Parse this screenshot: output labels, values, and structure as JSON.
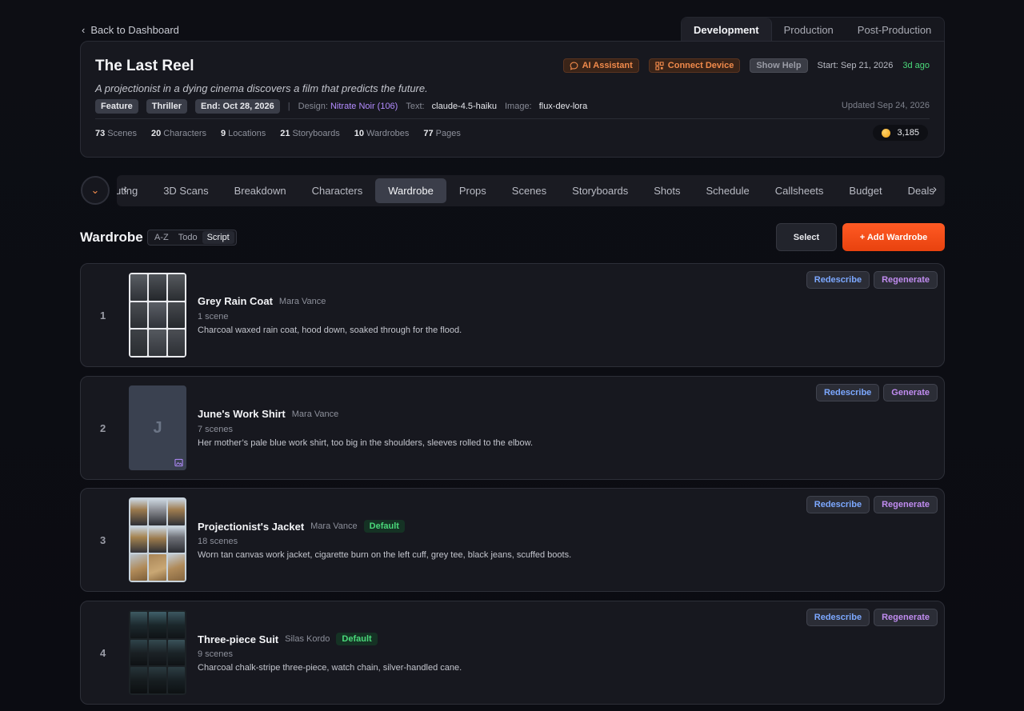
{
  "nav": {
    "back_label": "Back to Dashboard",
    "phase_tabs": [
      "Development",
      "Production",
      "Post-Production"
    ],
    "active_phase": "Development"
  },
  "project": {
    "title": "The Last Reel",
    "logline": "A projectionist in a dying cinema discovers a film that predicts the future.",
    "tags": [
      "Feature",
      "Thriller",
      "End: Oct 28, 2026"
    ],
    "design_label": "Design:",
    "design_value": "Nitrate Noir (106)",
    "text_label": "Text:",
    "text_value": "claude-4.5-haiku",
    "image_label": "Image:",
    "image_value": "flux-dev-lora",
    "ai_assistant_label": "AI Assistant",
    "connect_device_label": "Connect Device",
    "show_help_label": "Show Help",
    "start_date": "Start: Sep 21, 2026",
    "ago": "3d ago",
    "updated": "Updated Sep 24, 2026",
    "stats": [
      {
        "value": "73",
        "label": "Scenes"
      },
      {
        "value": "20",
        "label": "Characters"
      },
      {
        "value": "9",
        "label": "Locations"
      },
      {
        "value": "21",
        "label": "Storyboards"
      },
      {
        "value": "10",
        "label": "Wardrobes"
      },
      {
        "value": "77",
        "label": "Pages"
      }
    ],
    "credits": "3,185"
  },
  "section_nav": {
    "items": [
      "uting",
      "3D Scans",
      "Breakdown",
      "Characters",
      "Wardrobe",
      "Props",
      "Scenes",
      "Storyboards",
      "Shots",
      "Schedule",
      "Callsheets",
      "Budget",
      "Deals"
    ],
    "active": "Wardrobe"
  },
  "wardrobe": {
    "title": "Wardrobe",
    "sort_options": [
      "A-Z",
      "Todo",
      "Script"
    ],
    "active_sort": "Script",
    "select_label": "Select",
    "add_label": "+ Add Wardrobe",
    "items": [
      {
        "num": "1",
        "name": "Grey Rain Coat",
        "character": "Mara Vance",
        "default": "",
        "scenes": "1 scene",
        "description": "Charcoal waxed rain coat, hood down, soaked through for the flood.",
        "actions": [
          "Redescribe",
          "Regenerate"
        ]
      },
      {
        "num": "2",
        "name": "June's Work Shirt",
        "character": "Mara Vance",
        "default": "",
        "scenes": "7 scenes",
        "description": "Her mother’s pale blue work shirt, too big in the shoulders, sleeves rolled to the elbow.",
        "placeholder_letter": "J",
        "actions": [
          "Redescribe",
          "Generate"
        ]
      },
      {
        "num": "3",
        "name": "Projectionist's Jacket",
        "character": "Mara Vance",
        "default": "Default",
        "scenes": "18 scenes",
        "description": "Worn tan canvas work jacket, cigarette burn on the left cuff, grey tee, black jeans, scuffed boots.",
        "actions": [
          "Redescribe",
          "Regenerate"
        ]
      },
      {
        "num": "4",
        "name": "Three-piece Suit",
        "character": "Silas Kordo",
        "default": "Default",
        "scenes": "9 scenes",
        "description": "Charcoal chalk-stripe three-piece, watch chain, silver-handled cane.",
        "actions": [
          "Redescribe",
          "Regenerate"
        ]
      }
    ]
  },
  "colors": {
    "accent": "#f0592a",
    "success": "#4ad97a",
    "design_purple": "#b38cff",
    "redescribe_blue": "#7ca8ff",
    "regenerate_purple": "#c08cf0"
  }
}
